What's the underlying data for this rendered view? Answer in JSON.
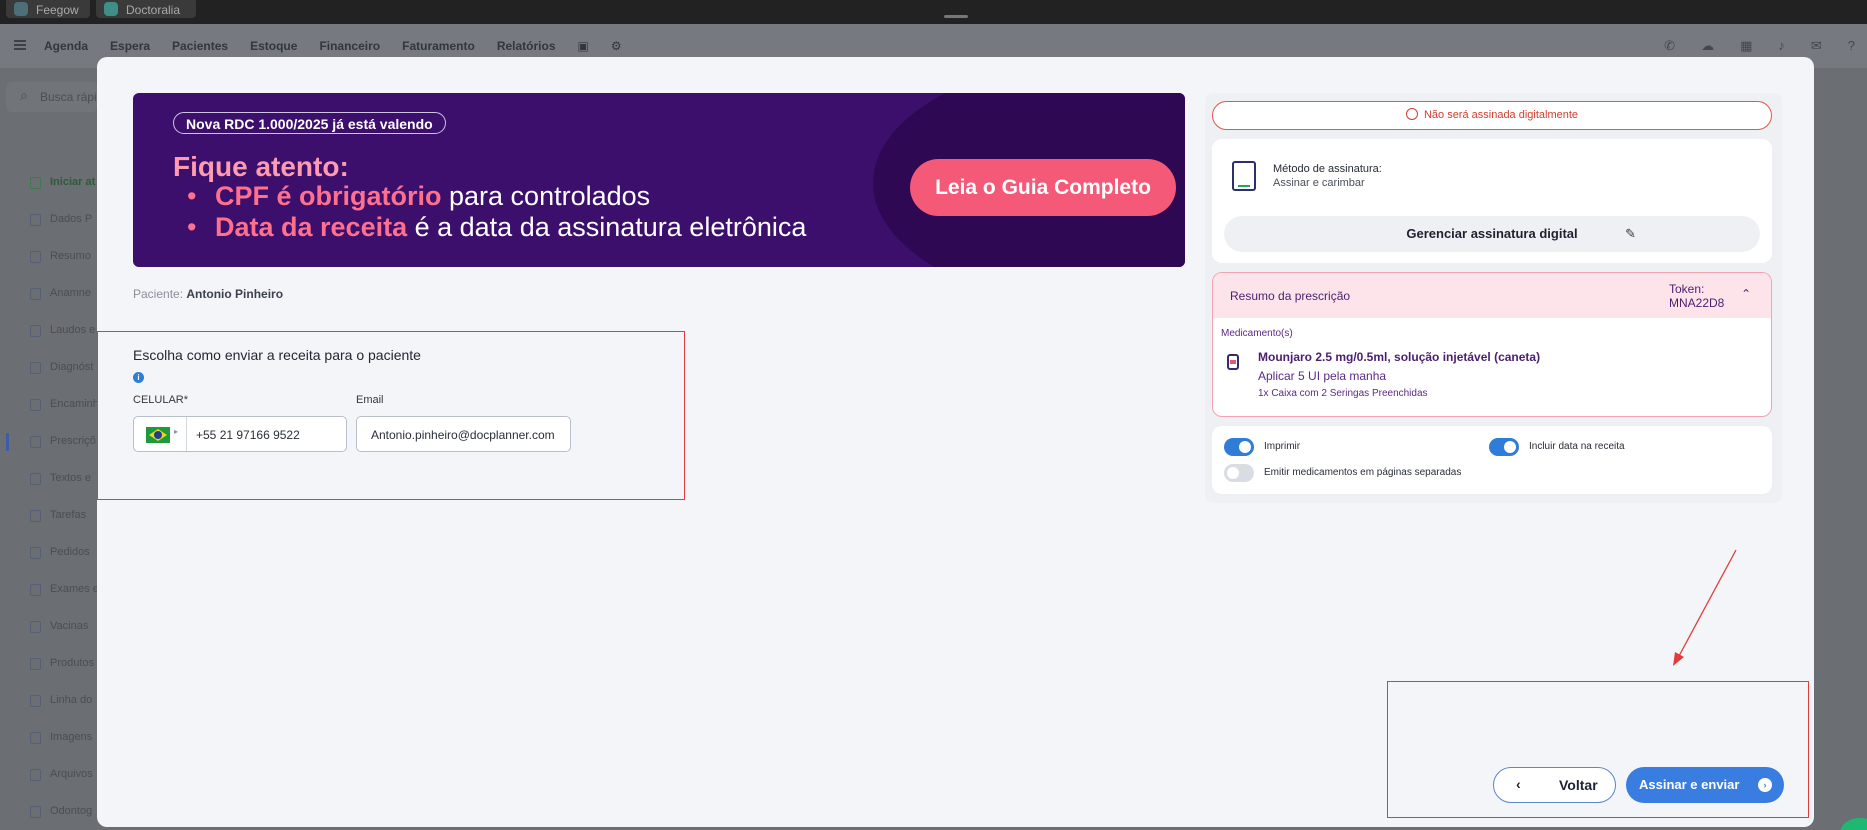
{
  "titlebar": {
    "tabs": [
      "Feegow",
      "Doctoralia"
    ]
  },
  "nav": {
    "items": [
      "Agenda",
      "Espera",
      "Pacientes",
      "Estoque",
      "Financeiro",
      "Faturamento",
      "Relatórios"
    ]
  },
  "background": {
    "search_placeholder": "Busca rápi",
    "sidebar": [
      "Iniciar at",
      "Dados P",
      "Resumo",
      "Anamne",
      "Laudos e",
      "Diagnóst",
      "Encaminh",
      "Prescriçõ",
      "Textos e",
      "Tarefas",
      "Pedidos",
      "Exames e",
      "Vacinas",
      "Produtos",
      "Linha do",
      "Imagens",
      "Arquivos",
      "Odontog"
    ]
  },
  "banner": {
    "pill": "Nova RDC 1.000/2025 já está valendo",
    "title": "Fique atento:",
    "line1_highlight": "CPF é obrigatório",
    "line1_rest": " para controlados",
    "line2_highlight": "Data da receita",
    "line2_rest": " é a data da assinatura eletrônica",
    "cta": "Leia o Guia Completo"
  },
  "patient": {
    "label": "Paciente:",
    "name": "Antonio Pinheiro"
  },
  "send": {
    "title": "Escolha como enviar a receita para o paciente",
    "phone_label": "CELULAR*",
    "phone_value": "+55 21 97166 9522",
    "email_label": "Email",
    "email_value": "Antonio.pinheiro@docplanner.com"
  },
  "signature": {
    "warning": "Não será assinada digitalmente",
    "method_label": "Método de assinatura:",
    "method_value": "Assinar e carimbar",
    "manage_button": "Gerenciar assinatura digital"
  },
  "prescription": {
    "title": "Resumo da prescrição",
    "token_label": "Token:",
    "token_value": "MNA22D8",
    "section": "Medicamento(s)",
    "med_name": "Mounjaro 2.5 mg/0.5ml, solução injetável (caneta)",
    "med_dose": "Aplicar 5 UI pela manha",
    "med_qty": "1x Caixa com 2 Seringas Preenchidas"
  },
  "options": {
    "print": {
      "label": "Imprimir",
      "on": true
    },
    "include_date": {
      "label": "Incluir data na receita",
      "on": true
    },
    "separate_pages": {
      "label": "Emitir medicamentos em páginas separadas",
      "on": false
    }
  },
  "footer": {
    "back": "Voltar",
    "sign": "Assinar e enviar"
  },
  "colors": {
    "brand_purple": "#3b0f6b",
    "accent_pink": "#f45977",
    "primary_blue": "#3a7de0",
    "annotation_red": "#e23b3b"
  }
}
